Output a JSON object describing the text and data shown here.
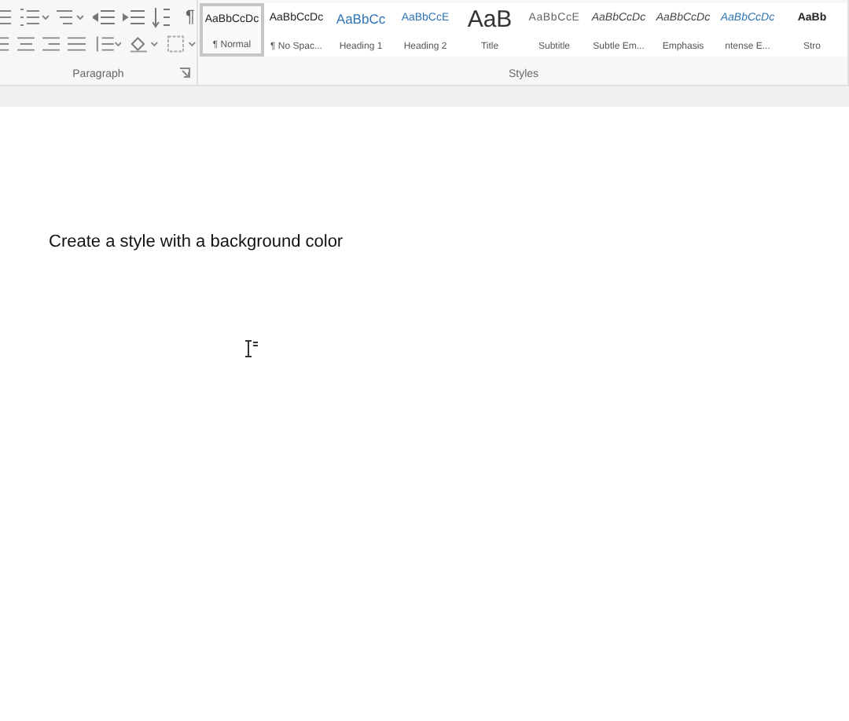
{
  "ribbon": {
    "paragraph_group": {
      "label": "Paragraph",
      "pilcrow": "¶"
    },
    "styles_group": {
      "label": "Styles",
      "items": [
        {
          "preview": "AaBbCcDc",
          "label": "¶ Normal",
          "kind": "normal",
          "selected": true
        },
        {
          "preview": "AaBbCcDc",
          "label": "¶ No Spac...",
          "kind": "normal",
          "selected": false
        },
        {
          "preview": "AaBbCc",
          "label": "Heading 1",
          "kind": "heading1",
          "selected": false
        },
        {
          "preview": "AaBbCcE",
          "label": "Heading 2",
          "kind": "heading2",
          "selected": false
        },
        {
          "preview": "AaB",
          "label": "Title",
          "kind": "title",
          "selected": false
        },
        {
          "preview": "AaBbCcE",
          "label": "Subtitle",
          "kind": "subtitle",
          "selected": false
        },
        {
          "preview": "AaBbCcDc",
          "label": "Subtle Em...",
          "kind": "emphasis",
          "selected": false
        },
        {
          "preview": "AaBbCcDc",
          "label": "Emphasis",
          "kind": "emphasis",
          "selected": false
        },
        {
          "preview": "AaBbCcDc",
          "label": "ntense E...",
          "kind": "intense",
          "selected": false
        },
        {
          "preview": "AaBb",
          "label": "Stro",
          "kind": "strong",
          "selected": false
        }
      ]
    }
  },
  "document": {
    "text": "Create a style with a background color"
  }
}
